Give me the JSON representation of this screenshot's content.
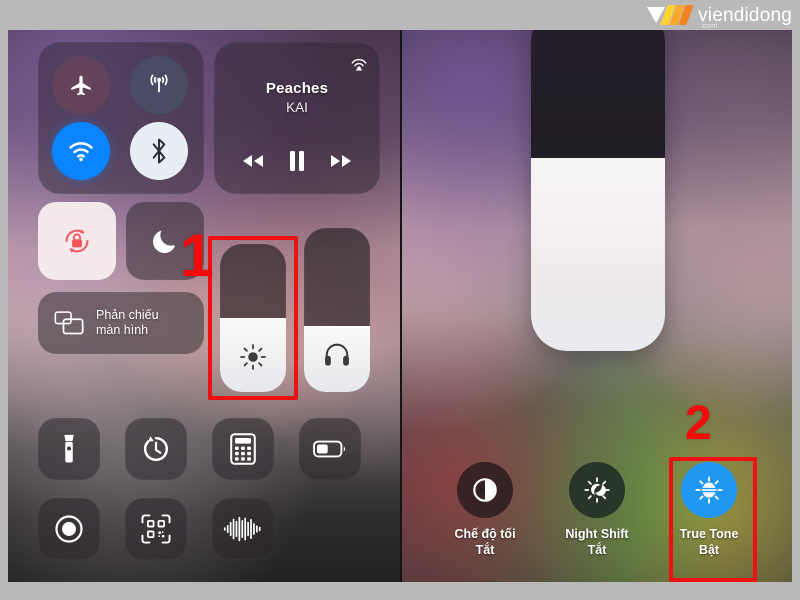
{
  "header": {
    "logo_name": "viendidong",
    "logo_tld": ".com",
    "logo_icon": "triangle-stripes-logo"
  },
  "left_panel": {
    "name": "ios-control-center",
    "toggles": [
      {
        "id": "airplane",
        "icon": "airplane-icon",
        "state": "off",
        "color": "#6e4655"
      },
      {
        "id": "cellular",
        "icon": "cellular-icon",
        "state": "off",
        "color": "#465569"
      },
      {
        "id": "wifi",
        "icon": "wifi-icon",
        "state": "on",
        "color": "#0a84ff"
      },
      {
        "id": "bluetooth",
        "icon": "bluetooth-icon",
        "state": "on",
        "color": "#e8eef5"
      }
    ],
    "media": {
      "title": "Peaches",
      "artist": "KAI",
      "airplay_icon": "airplay-audio-icon",
      "controls": [
        {
          "id": "rewind",
          "icon": "rewind-icon"
        },
        {
          "id": "pause",
          "icon": "pause-icon"
        },
        {
          "id": "forward",
          "icon": "fast-forward-icon"
        }
      ]
    },
    "tiles": [
      {
        "id": "rotation-lock",
        "icon": "rotation-lock-icon",
        "state": "on"
      },
      {
        "id": "do-not-disturb",
        "icon": "moon-icon",
        "state": "off"
      }
    ],
    "screen_mirroring": {
      "icon": "screen-mirroring-icon",
      "label_line1": "Phản chiếu",
      "label_line2": "màn hình"
    },
    "sliders": [
      {
        "id": "brightness",
        "icon": "brightness-sun-icon",
        "value": 50
      },
      {
        "id": "volume",
        "icon": "headphones-icon",
        "value": 40
      }
    ],
    "shortcuts": [
      {
        "id": "flashlight",
        "icon": "flashlight-icon"
      },
      {
        "id": "timer",
        "icon": "timer-icon"
      },
      {
        "id": "calculator",
        "icon": "calculator-icon"
      },
      {
        "id": "low-power",
        "icon": "battery-icon"
      },
      {
        "id": "screen-record",
        "icon": "record-icon"
      },
      {
        "id": "qr-scanner",
        "icon": "qr-code-icon"
      },
      {
        "id": "hearing",
        "icon": "sound-wave-icon"
      }
    ]
  },
  "right_panel": {
    "name": "brightness-expanded-view",
    "big_slider": {
      "id": "brightness-expanded",
      "icon": "brightness-sun-icon",
      "value": 56
    },
    "modes": [
      {
        "id": "dark-mode",
        "icon": "dark-mode-icon",
        "name": "Chế độ tối",
        "state": "Tắt",
        "active": false
      },
      {
        "id": "night-shift",
        "icon": "night-shift-icon",
        "name": "Night Shift",
        "state": "Tắt",
        "active": false
      },
      {
        "id": "true-tone",
        "icon": "true-tone-icon",
        "name": "True Tone",
        "state": "Bật",
        "active": true
      }
    ]
  },
  "annotations": {
    "marker_one": "1",
    "marker_two": "2",
    "box_color": "#ee1111"
  }
}
